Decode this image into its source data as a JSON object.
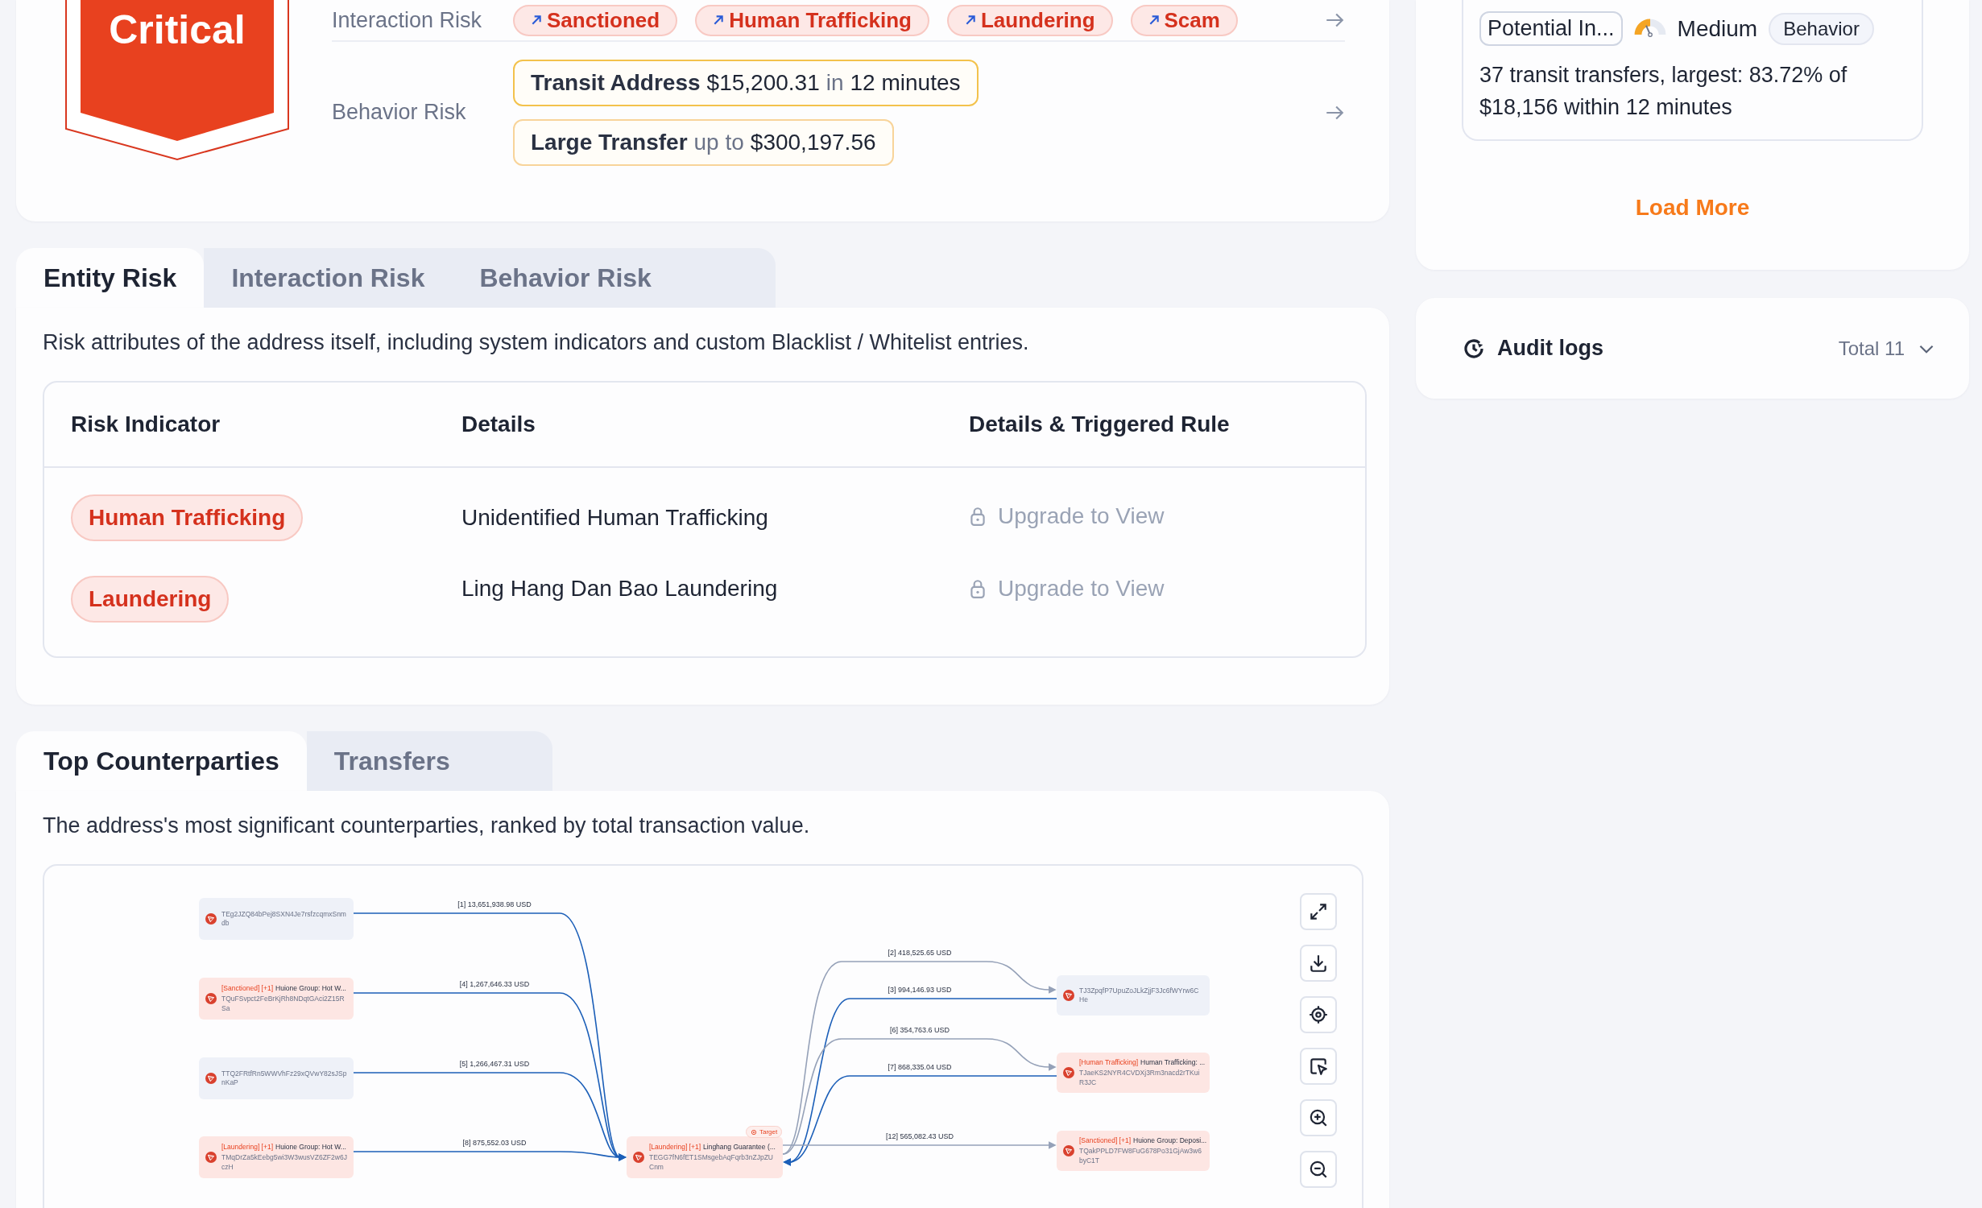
{
  "summary": {
    "risk_level": "Critical",
    "interaction_risk": {
      "label": "Interaction Risk",
      "tags": [
        "Sanctioned",
        "Human Trafficking",
        "Laundering",
        "Scam"
      ]
    },
    "behavior_risk": {
      "label": "Behavior Risk",
      "tags": [
        {
          "segments": [
            {
              "kind": "title",
              "text": "Transit Address"
            },
            {
              "kind": "value",
              "text": "$15,200.31"
            },
            {
              "kind": "muted",
              "text": "in"
            },
            {
              "kind": "value",
              "text": "12 minutes"
            }
          ]
        },
        {
          "segments": [
            {
              "kind": "title",
              "text": "Large Transfer"
            },
            {
              "kind": "muted",
              "text": "up to"
            },
            {
              "kind": "value",
              "text": "$300,197.56"
            }
          ]
        }
      ]
    }
  },
  "entity_tabs": [
    {
      "label": "Entity Risk",
      "selected": true
    },
    {
      "label": "Interaction Risk",
      "selected": false
    },
    {
      "label": "Behavior Risk",
      "selected": false
    }
  ],
  "entity_risk": {
    "description": "Risk attributes of the address itself, including system indicators and custom Blacklist / Whitelist entries.",
    "columns": [
      "Risk Indicator",
      "Details",
      "Details & Triggered Rule"
    ],
    "rows": [
      {
        "indicator": "Human Trafficking",
        "details": "Unidentified Human Trafficking",
        "rule": "Upgrade to View",
        "locked": true
      },
      {
        "indicator": "Laundering",
        "details": "Ling Hang Dan Bao Laundering",
        "rule": "Upgrade to View",
        "locked": true
      }
    ]
  },
  "counterparty_tabs": [
    {
      "label": "Top Counterparties",
      "selected": true
    },
    {
      "label": "Transfers",
      "selected": false
    }
  ],
  "counterparties": {
    "description": "The address's most significant counterparties, ranked by total transaction value.",
    "nodes": [
      {
        "address": "TEg2JZQ84bPej8SXN4Je7rsfzcqmxSnmdb",
        "flagged": false
      },
      {
        "tags": "[Sanctioned] [+1]",
        "name": "Huione Group: Hot W...",
        "address": "TQuFSvpct2FeBrKjRh8NDqtGAci2Z15RSa",
        "flagged": true
      },
      {
        "address": "TTQ2FRtfRn5WWVhFz29xQVwY82sJSpnKaP",
        "flagged": false
      },
      {
        "tags": "[Laundering] [+1]",
        "name": "Huione Group: Hot W...",
        "address": "TMqDrZa5kEebg5wi3W3wusVZ6ZF2w6JczH",
        "flagged": true
      },
      {
        "tags": "[Laundering] [+1]",
        "name": "Linghang Guarantee (...",
        "address": "TEGG7fN6fET1SMsgebAqFqrb3nZJpZUCnm",
        "flagged": true,
        "badge": "Target"
      },
      {
        "address": "TJ3ZpqfP7UpuZoJLkZjjF3Jc6fWYrw6CHe",
        "flagged": false
      },
      {
        "tags": "[Human Trafficking]",
        "name": "Human Trafficking: ...",
        "address": "TJaeKS2NYR4CVDXj3Rm3nacd2rTKuiR3JC",
        "flagged": true
      },
      {
        "tags": "[Sanctioned] [+1]",
        "name": "Huione Group: Deposi...",
        "address": "TQakPPLD7FW8FuG678Po31GjAw3w6byC1T",
        "flagged": true
      }
    ],
    "edges": [
      {
        "label": "[1] 13,651,938.98 USD",
        "kind": "inflow"
      },
      {
        "label": "[4] 1,267,646.33 USD",
        "kind": "inflow"
      },
      {
        "label": "[5] 1,266,467.31 USD",
        "kind": "inflow"
      },
      {
        "label": "[8] 875,552.03 USD",
        "kind": "inflow"
      },
      {
        "label": "[2] 418,525.65 USD",
        "kind": "outflow"
      },
      {
        "label": "[3] 994,146.93 USD",
        "kind": "inflow"
      },
      {
        "label": "[6] 354,763.6 USD",
        "kind": "outflow"
      },
      {
        "label": "[7] 868,335.04 USD",
        "kind": "inflow"
      },
      {
        "label": "[12] 565,082.43 USD",
        "kind": "outflow"
      }
    ]
  },
  "alert": {
    "chip": "Potential In...",
    "level": 0.5,
    "severity": "Medium",
    "category": "Behavior",
    "description": "37 transit transfers, largest: 83.72% of $18,156 within 12 minutes"
  },
  "load_more": "Load More",
  "audit_logs": {
    "title": "Audit logs",
    "total": "Total 11",
    "expanded": false
  }
}
